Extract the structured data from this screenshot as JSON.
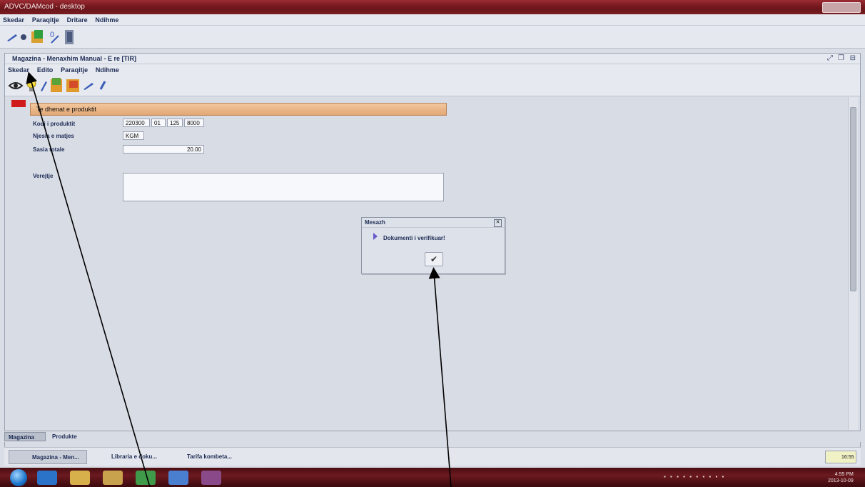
{
  "os_window": {
    "title": "ADVC/DAMcod - desktop"
  },
  "app_menu": [
    "Skedar",
    "Paraqitje",
    "Dritare",
    "Ndihme"
  ],
  "inner_window": {
    "title": "Magazina - Menaxhim Manual - E re [TIR]",
    "menu": [
      "Skedar",
      "Edito",
      "Paraqitje",
      "Ndihme"
    ]
  },
  "form": {
    "section_header": "Te dhenat e produktit",
    "fields": [
      {
        "label": "Kodi i produktit",
        "values": [
          "220300",
          "01",
          "125",
          "8000"
        ]
      },
      {
        "label": "Njesia e matjes",
        "values": [
          "KGM"
        ]
      },
      {
        "label": "Sasia totale",
        "values": [
          "20.00"
        ]
      },
      {
        "label": "Verejtje",
        "values": [
          ""
        ]
      }
    ]
  },
  "dialog": {
    "title": "Mesazh",
    "close_glyph": "✕",
    "message": "Dokumenti i verifikuar!",
    "ok_glyph": "✔"
  },
  "tabs": [
    {
      "label": "Magazina",
      "active": true
    },
    {
      "label": "Produkte",
      "active": false
    }
  ],
  "task_items": [
    {
      "label": "Magazina - Men...",
      "active": true
    },
    {
      "label": "Libraria e doku...",
      "active": false
    },
    {
      "label": "Tarifa kombeta...",
      "active": false
    }
  ],
  "app_clock": "16:55",
  "system_clock": {
    "time": "4:55 PM",
    "date": "2013-10-09"
  },
  "icons": [
    "start-orb-icon",
    "ie-icon",
    "folder-icon",
    "media-icon",
    "excel-icon",
    "app-icon",
    "word-icon"
  ],
  "colors": {
    "title_bar": "#7a1c22",
    "header_orange": "#e9b282",
    "flag_red": "#d11a1a"
  }
}
